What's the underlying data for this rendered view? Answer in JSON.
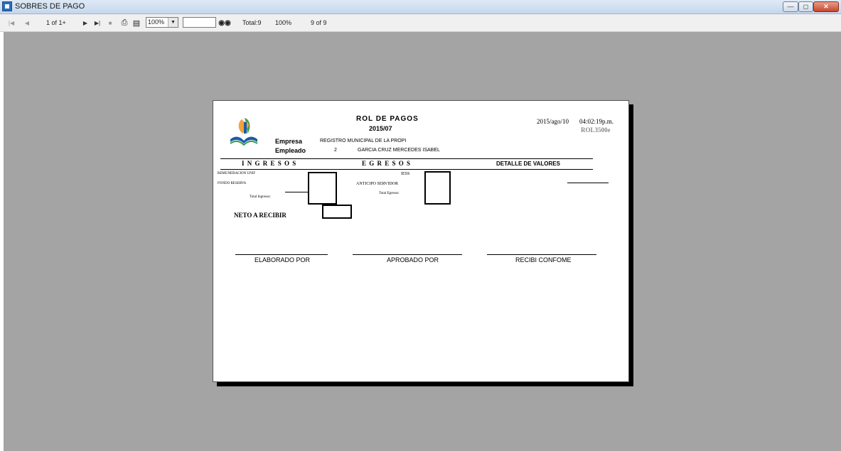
{
  "window": {
    "title": "SOBRES DE PAGO"
  },
  "toolbar": {
    "page_indicator": "1 of 1+",
    "zoom": "100%",
    "find_value": "",
    "total": "Total:9",
    "percent": "100%",
    "records": "9 of 9"
  },
  "report": {
    "title": "ROL  DE  PAGOS",
    "period": "2015/07",
    "date": "2015/ago/10",
    "time": "04:02:19p.m.",
    "code": "ROL3500e",
    "empresa_label": "Empresa",
    "empresa_value": "REGISTRO MUNICIPAL DE LA PROPI",
    "empleado_label": "Empleado",
    "empleado_id": "2",
    "empleado_name": "GARCIA CRUZ MERCEDES ISABEL",
    "headers": {
      "ingresos": "I N G R E S O S",
      "egresos": "E G R E S O S",
      "detalle": "DETALLE DE VALORES"
    },
    "ingresos": [
      "REMUNERACION UNIF",
      "FONDO RESERVA"
    ],
    "total_ingresos": "Total Ingresos:",
    "egresos": [
      "IESS",
      "ANTICIPO SERVIDOR"
    ],
    "total_egresos": "Total Egresos:",
    "neto": "NETO A RECIBIR",
    "signatures": [
      "ELABORADO POR",
      "APROBADO POR",
      "RECIBI CONFOME"
    ]
  },
  "colors": {
    "viewer_bg": "#a4a4a4",
    "page_bg": "#ffffff",
    "titlebar": "#c6d7ec",
    "logo_orange": "#f2a33a",
    "logo_green": "#3aa04a",
    "logo_blue": "#1e5aa8"
  }
}
